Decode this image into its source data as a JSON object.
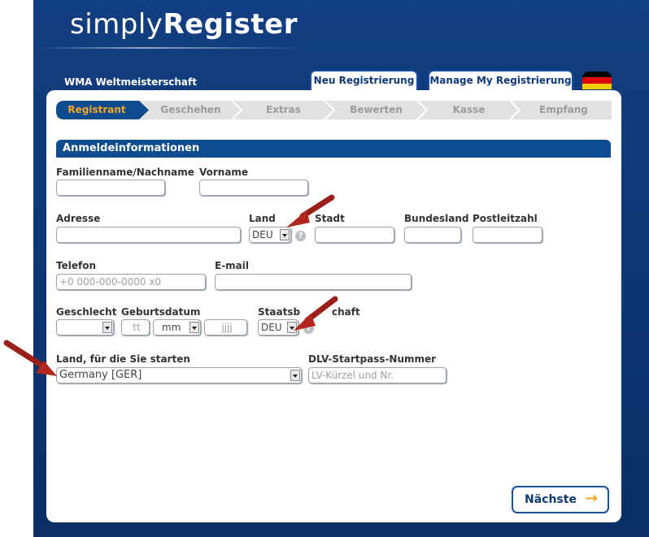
{
  "brand": {
    "prefix": "simply",
    "name": "Register"
  },
  "event_name": "WMA Weltmeisterschaft",
  "top_tabs": [
    {
      "label": "Neu Registrierung"
    },
    {
      "label": "Manage My Registrierung"
    }
  ],
  "flag": {
    "colors": [
      "#000000",
      "#dd0000",
      "#ffce00"
    ]
  },
  "steps": [
    {
      "label": "Registrant",
      "state": "active"
    },
    {
      "label": "Geschehen",
      "state": "inactive"
    },
    {
      "label": "Extras",
      "state": "inactive"
    },
    {
      "label": "Bewerten",
      "state": "inactive"
    },
    {
      "label": "Kasse",
      "state": "inactive"
    },
    {
      "label": "Empfang",
      "state": "inactive"
    }
  ],
  "section_title": "Anmeldeinformationen",
  "form": {
    "lastname_label": "Familienname/Nachname",
    "firstname_label": "Vorname",
    "address_label": "Adresse",
    "country_label": "Land",
    "country_value": "DEU",
    "city_label": "Stadt",
    "state_label": "Bundesland",
    "zip_label": "Postleitzahl",
    "phone_label": "Telefon",
    "phone_placeholder": "+0 000-000-0000 x0",
    "email_label": "E-mail",
    "gender_label": "Geschlecht",
    "birthdate_label": "Geburtsdatum",
    "day_placeholder": "tt",
    "month_value": "mm",
    "year_placeholder": "jjjj",
    "citizenship_label": "Staatsbürgerschaft",
    "citizenship_label_visible_start": "Staatsb",
    "citizenship_label_visible_end": "chaft",
    "citizenship_value": "DEU",
    "compete_country_label": "Land, für die Sie starten",
    "compete_country_value": "Germany [GER]",
    "dlv_label": "DLV-Startpass-Nummer",
    "dlv_placeholder": "LV-Kürzel und Nr.",
    "help_symbol": "?"
  },
  "next_button": {
    "label": "Nächste",
    "arrow": "→"
  },
  "colors": {
    "header_bg": "#0f3a78",
    "section_bg": "#0f4b8f",
    "active_step_bg": "#0f4b8f",
    "active_step_text": "#f5a623",
    "annotation_arrow": "#b3261e"
  }
}
